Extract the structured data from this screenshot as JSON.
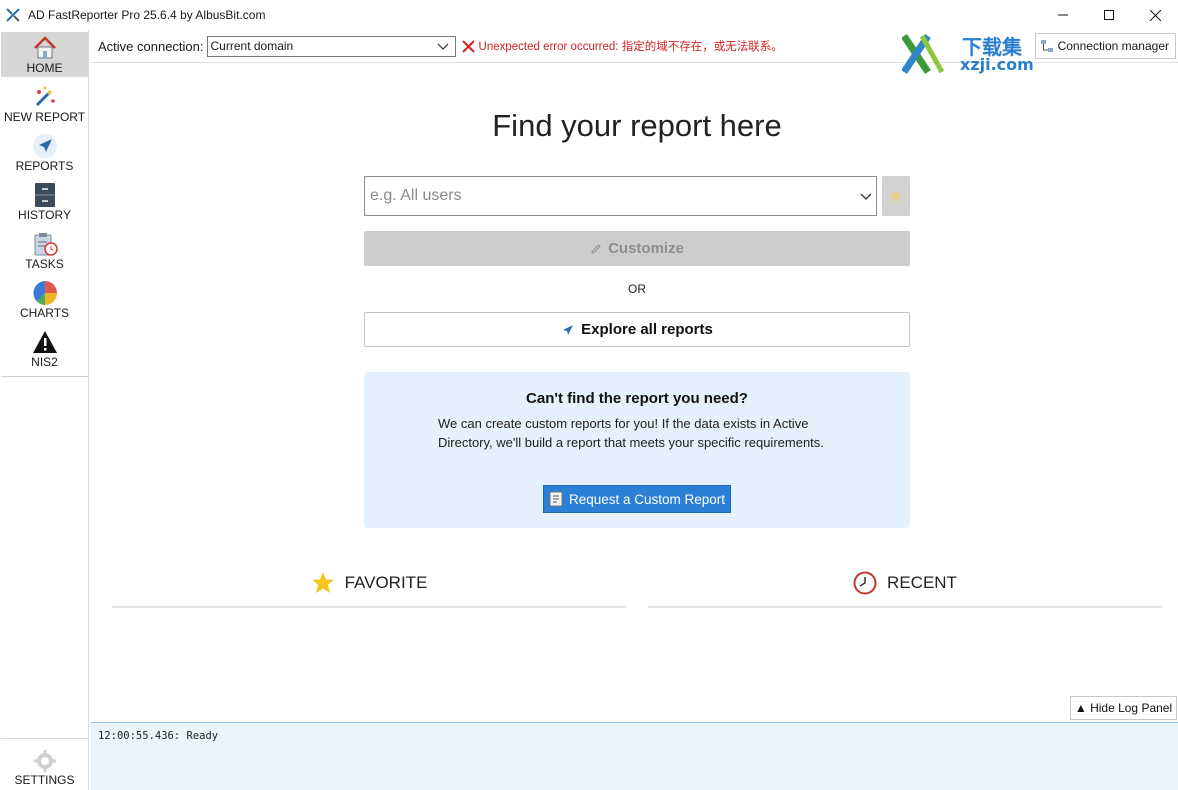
{
  "window": {
    "title": "AD FastReporter Pro 25.6.4 by AlbusBit.com"
  },
  "sidebar": {
    "items": [
      {
        "label": "HOME",
        "icon": "home-icon"
      },
      {
        "label": "NEW REPORT",
        "icon": "magic-wand-icon"
      },
      {
        "label": "REPORTS",
        "icon": "navigation-arrow-icon"
      },
      {
        "label": "HISTORY",
        "icon": "cabinet-icon"
      },
      {
        "label": "TASKS",
        "icon": "clipboard-clock-icon"
      },
      {
        "label": "CHARTS",
        "icon": "pie-chart-icon"
      },
      {
        "label": "NIS2",
        "icon": "warning-icon"
      }
    ],
    "settings_label": "SETTINGS"
  },
  "topbar": {
    "connection_label": "Active connection:",
    "connection_value": "Current domain",
    "error_text": "Unexpected error occurred: 指定的域不存在，或无法联系。",
    "connection_manager_label": "Connection manager"
  },
  "watermark": {
    "line1": "下载集",
    "line2": "xzji.com"
  },
  "main": {
    "heading": "Find your report here",
    "search_placeholder": "e.g. All users",
    "customize_label": "Customize",
    "or_label": "OR",
    "explore_label": "Explore all reports",
    "custom_box": {
      "title": "Can't find the report you need?",
      "text": "We can create custom reports for you! If the data exists in Active Directory, we'll build a report that meets your specific requirements.",
      "button_label": "Request a Custom Report"
    },
    "favorite_label": "FAVORITE",
    "recent_label": "RECENT"
  },
  "log": {
    "hide_button_label": "▲ Hide Log Panel",
    "lines": [
      "12:00:55.436: Ready"
    ]
  },
  "colors": {
    "accent": "#2b7fd4",
    "error": "#d42222",
    "log_bg": "#eaf4fc",
    "custom_box_bg": "#e4f0fb"
  }
}
